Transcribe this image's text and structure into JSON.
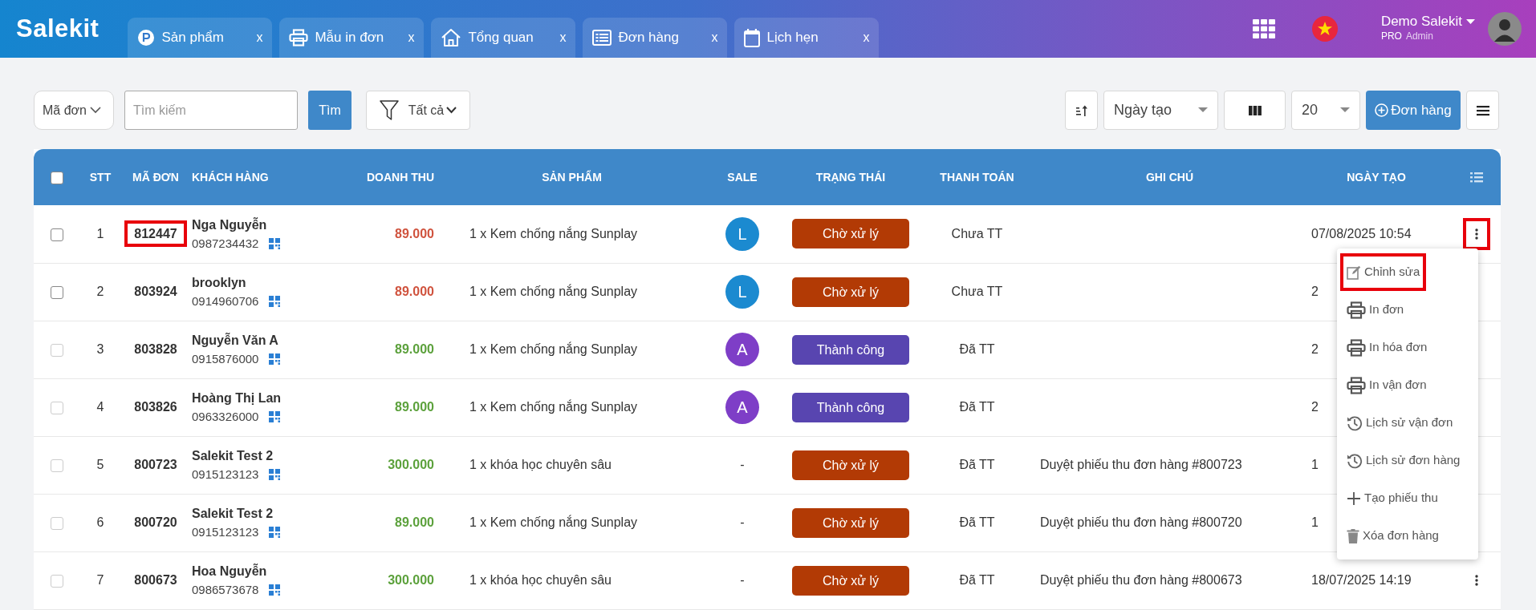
{
  "header": {
    "logo": "Salekit",
    "tabs": [
      {
        "kind": "products",
        "label": "Sản phẩm",
        "close": "x"
      },
      {
        "kind": "print",
        "label": "Mẫu in đơn",
        "close": "x"
      },
      {
        "kind": "home",
        "label": "Tổng quan",
        "close": "x"
      },
      {
        "kind": "orders",
        "label": "Đơn hàng",
        "close": "x"
      },
      {
        "kind": "calendar",
        "label": "Lịch hẹn",
        "close": "x"
      }
    ],
    "user": {
      "name": "Demo Salekit",
      "plan": "PRO",
      "role": "Admin"
    }
  },
  "toolbar": {
    "search_by": "Mã đơn",
    "search": {
      "placeholder": "Tìm kiếm"
    },
    "search_button": "Tìm",
    "filter": "Tất cả",
    "sort_field": "Ngày tạo",
    "page_size": "20",
    "add_button": "Đơn hàng"
  },
  "table": {
    "select_all_checked": false,
    "columns": [
      "STT",
      "MÃ ĐƠN",
      "KHÁCH HÀNG",
      "DOANH THU",
      "SẢN PHẨM",
      "SALE",
      "TRẠNG THÁI",
      "THANH TOÁN",
      "GHI CHÚ",
      "NGÀY TẠO"
    ],
    "rows": [
      {
        "disabled": false,
        "stt": "1",
        "code": "812447",
        "code_highlighted": true,
        "customer": "Nga Nguyễn",
        "phone": "0987234432",
        "revenue": "89.000",
        "paid": false,
        "product": "1 x Kem chống nắng Sunplay",
        "sale": {
          "initial": "L",
          "color": "#1b8ad0"
        },
        "status": {
          "label": "Chờ xử lý",
          "color": "#b23a05"
        },
        "payment": "Chưa TT",
        "date": "07/08/2025 10:54",
        "more": {
          "highlighted": true
        }
      },
      {
        "disabled": false,
        "stt": "2",
        "code": "803924",
        "code_highlighted": false,
        "customer": "brooklyn",
        "phone": "0914960706",
        "revenue": "89.000",
        "paid": false,
        "product": "1 x Kem chống nắng Sunplay",
        "sale": {
          "initial": "L",
          "color": "#1b8ad0"
        },
        "status": {
          "label": "Chờ xử lý",
          "color": "#b23a05"
        },
        "payment": "Chưa TT",
        "date": "2"
      },
      {
        "disabled": true,
        "stt": "3",
        "code": "803828",
        "code_highlighted": false,
        "customer": "Nguyễn Văn A",
        "phone": "0915876000",
        "revenue": "89.000",
        "paid": true,
        "product": "1 x Kem chống nắng Sunplay",
        "sale": {
          "initial": "A",
          "color": "#7e3ec7"
        },
        "status": {
          "label": "Thành công",
          "color": "#5845b0"
        },
        "payment": "Đã TT",
        "date": "2"
      },
      {
        "disabled": true,
        "stt": "4",
        "code": "803826",
        "code_highlighted": false,
        "customer": "Hoàng Thị Lan",
        "phone": "0963326000",
        "revenue": "89.000",
        "paid": true,
        "product": "1 x Kem chống nắng Sunplay",
        "sale": {
          "initial": "A",
          "color": "#7e3ec7"
        },
        "status": {
          "label": "Thành công",
          "color": "#5845b0"
        },
        "payment": "Đã TT",
        "date": "2"
      },
      {
        "disabled": true,
        "stt": "5",
        "code": "800723",
        "code_highlighted": false,
        "customer": "Salekit Test 2",
        "phone": "0915123123",
        "revenue": "300.000",
        "paid": true,
        "product": "1 x khóa học chuyên sâu",
        "sale": {
          "initial": "-"
        },
        "status": {
          "label": "Chờ xử lý",
          "color": "#b23a05"
        },
        "payment": "Đã TT",
        "note": "Duyệt phiếu thu đơn hàng #800723",
        "date": "1"
      },
      {
        "disabled": true,
        "stt": "6",
        "code": "800720",
        "code_highlighted": false,
        "customer": "Salekit Test 2",
        "phone": "0915123123",
        "revenue": "89.000",
        "paid": true,
        "product": "1 x Kem chống nắng Sunplay",
        "sale": {
          "initial": "-"
        },
        "status": {
          "label": "Chờ xử lý",
          "color": "#b23a05"
        },
        "payment": "Đã TT",
        "note": "Duyệt phiếu thu đơn hàng #800720",
        "date": "1"
      },
      {
        "disabled": true,
        "stt": "7",
        "code": "800673",
        "code_highlighted": false,
        "customer": "Hoa Nguyễn",
        "phone": "0986573678",
        "revenue": "300.000",
        "paid": true,
        "product": "1 x khóa học chuyên sâu",
        "sale": {
          "initial": "-"
        },
        "status": {
          "label": "Chờ xử lý",
          "color": "#b23a05"
        },
        "payment": "Đã TT",
        "note": "Duyệt phiếu thu đơn hàng #800673",
        "date": "18/07/2025 14:19",
        "more": {
          "highlighted": false
        }
      }
    ]
  },
  "row_menu": {
    "items": [
      {
        "kind": "edit",
        "label": "Chỉnh sửa",
        "highlighted": true
      },
      {
        "kind": "print",
        "label": "In đơn",
        "highlighted": false
      },
      {
        "kind": "print",
        "label": "In hóa đơn",
        "highlighted": false
      },
      {
        "kind": "print",
        "label": "In vận đơn",
        "highlighted": false
      },
      {
        "kind": "history",
        "label": "Lịch sử vận đơn",
        "highlighted": false
      },
      {
        "kind": "history",
        "label": "Lịch sử đơn hàng",
        "highlighted": false
      },
      {
        "kind": "add",
        "label": "Tạo phiếu thu",
        "highlighted": false
      },
      {
        "kind": "delete",
        "label": "Xóa đơn hàng",
        "highlighted": false
      }
    ]
  }
}
